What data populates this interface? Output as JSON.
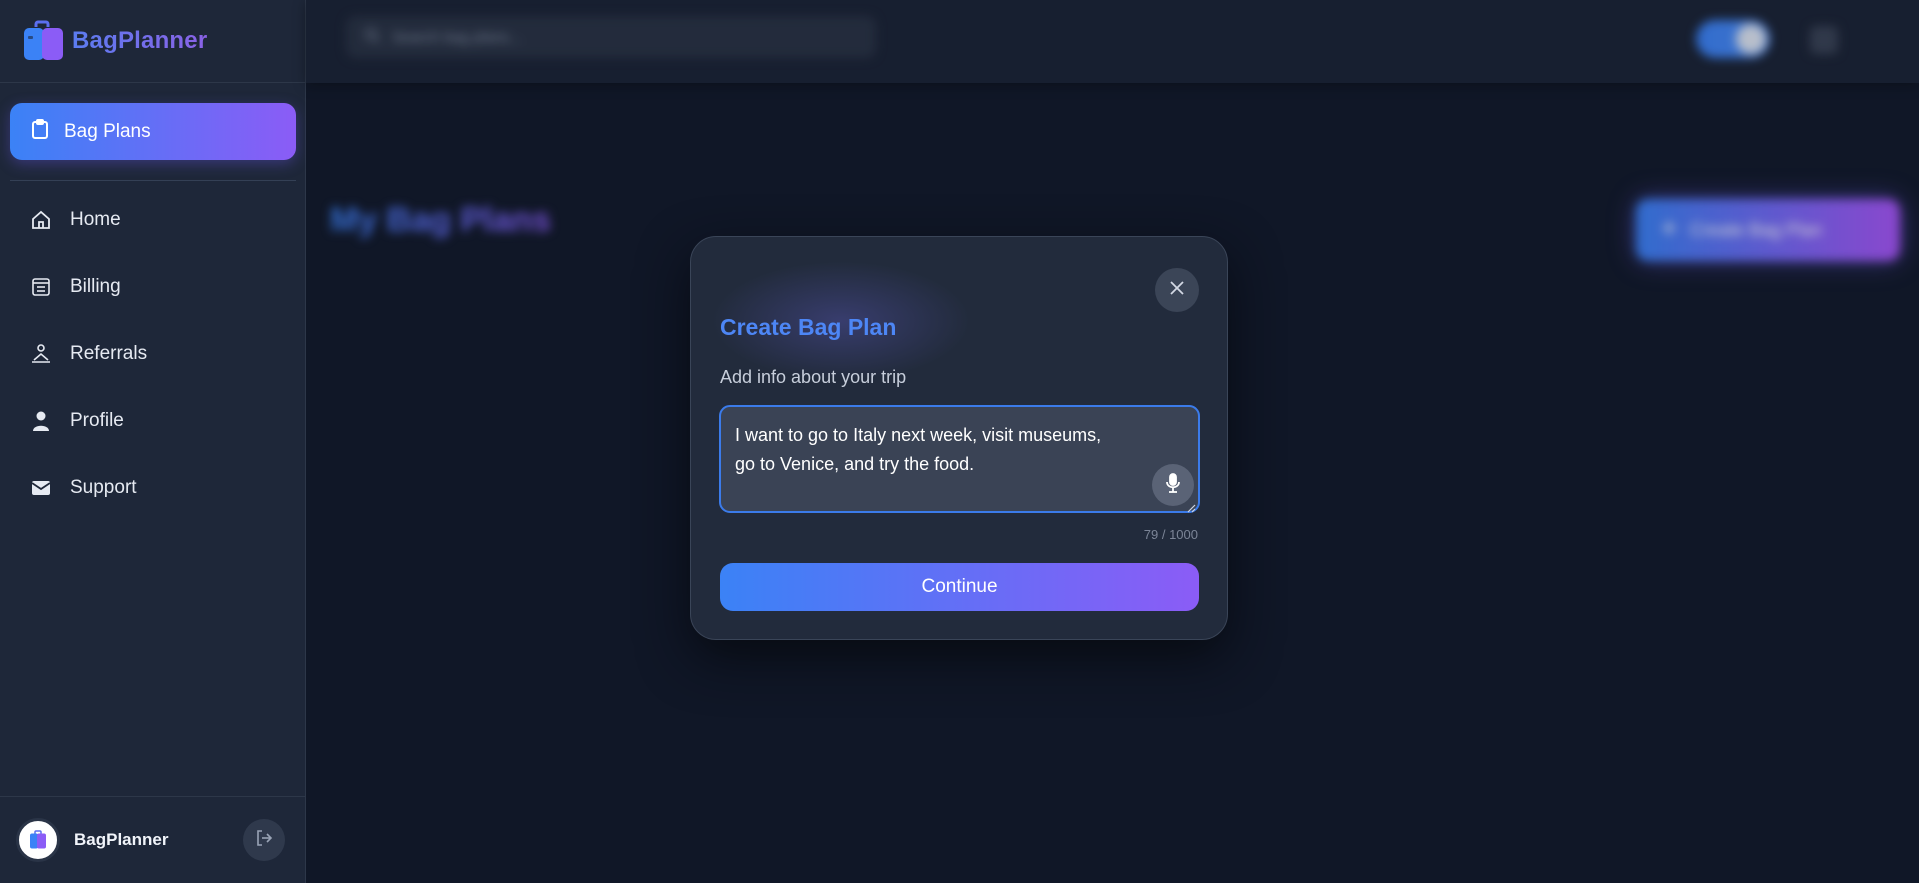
{
  "brand": {
    "name": "BagPlanner",
    "colors": {
      "gradient_start": "#3b82f6",
      "gradient_end": "#8b5cf6"
    }
  },
  "sidebar": {
    "active_item": {
      "label": "Bag Plans",
      "icon": "clipboard-icon"
    },
    "items": [
      {
        "label": "Home",
        "icon": "home-icon"
      },
      {
        "label": "Billing",
        "icon": "receipt-icon"
      },
      {
        "label": "Referrals",
        "icon": "referrals-icon"
      },
      {
        "label": "Profile",
        "icon": "user-icon"
      },
      {
        "label": "Support",
        "icon": "mail-icon"
      }
    ],
    "footer": {
      "name": "BagPlanner",
      "logout_icon": "logout-icon"
    }
  },
  "topbar": {
    "search_placeholder": "Search bag plans...",
    "theme_toggle": "on"
  },
  "page": {
    "title": "My Bag Plans",
    "create_button_label": "Create Bag Plan"
  },
  "modal": {
    "title": "Create Bag Plan",
    "label": "Add info about your trip",
    "textarea_value": "I want to go to Italy next week, visit museums, go to Venice, and try the food.",
    "char_count": "79 / 1000",
    "continue_label": "Continue",
    "close_icon": "close-icon",
    "mic_icon": "microphone-icon"
  }
}
